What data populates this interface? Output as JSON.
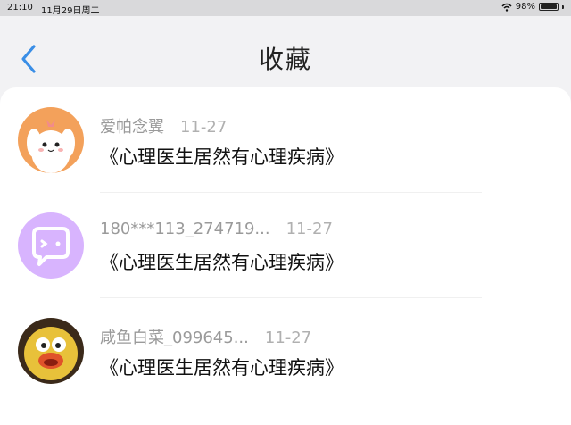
{
  "status": {
    "time": "21:10",
    "date": "11月29日周二",
    "battery": "98%",
    "battery_level": 0.98
  },
  "nav": {
    "title": "收藏",
    "back_icon": "chevron-left-icon"
  },
  "colors": {
    "accent": "#3a8ee6",
    "avatar1": "#f3a15b",
    "avatar2": "#d8b4fe",
    "avatar3": "#3b2a1a"
  },
  "items": [
    {
      "user": "爱帕念翼",
      "date": "11-27",
      "title": "《心理医生居然有心理疾病》",
      "avatar": "dog-avatar"
    },
    {
      "user": "180***113_274719...",
      "date": "11-27",
      "title": "《心理医生居然有心理疾病》",
      "avatar": "chat-bubble-avatar"
    },
    {
      "user": "咸鱼白菜_099645...",
      "date": "11-27",
      "title": "《心理医生居然有心理疾病》",
      "avatar": "duck-avatar"
    }
  ]
}
